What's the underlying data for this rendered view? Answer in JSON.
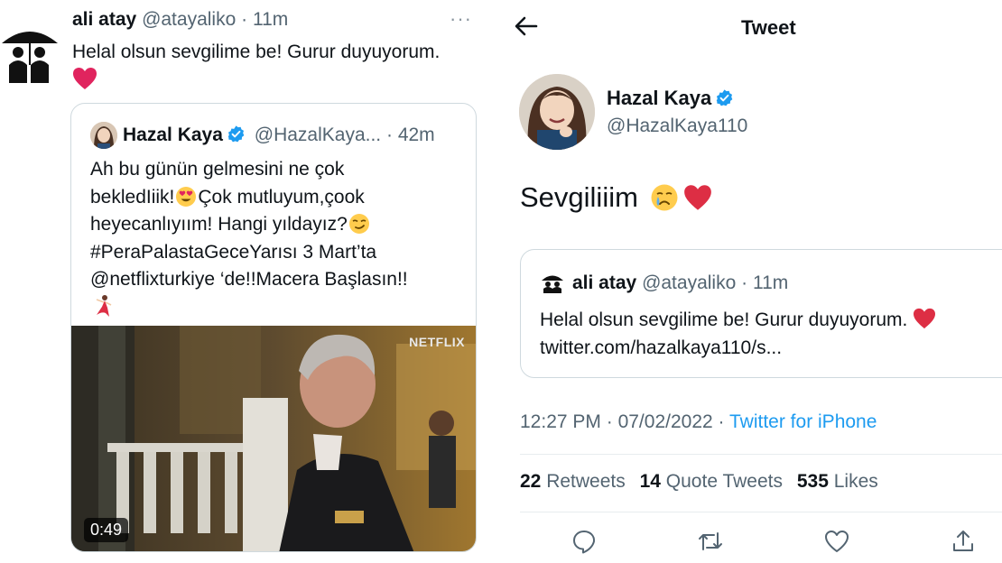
{
  "left_tweet": {
    "author_name": "ali atay",
    "author_handle": "@atayaliko",
    "separator": "·",
    "time": "11m",
    "more": "···",
    "text": "Helal olsun sevgilime be! Gurur duyuyorum.",
    "quoted": {
      "author_name": "Hazal Kaya",
      "author_handle": "@HazalKaya...",
      "separator": "·",
      "time": "42m",
      "lines": [
        "Ah bu günün gelmesini ne çok",
        "bekledIiik!",
        "Çok mutluyum,çook",
        "heyecanlıyıım! Hangi yıldayız?",
        "#PeraPalastaGeceYarısı 3 Mart’ta",
        "@netflixturkiye ‘de!!Macera Başlasın!!"
      ],
      "video": {
        "duration": "0:49",
        "brand": "NETFLIX"
      }
    }
  },
  "detail": {
    "header_title": "Tweet",
    "author_name": "Hazal Kaya",
    "author_handle": "@HazalKaya110",
    "text": "Sevgiliiim",
    "quoted": {
      "author_name": "ali atay",
      "author_handle": "@atayaliko",
      "separator": "·",
      "time": "11m",
      "line1": "Helal olsun sevgilime be! Gurur duyuyorum.",
      "line2": "twitter.com/hazalkaya110/s..."
    },
    "time": "12:27 PM",
    "separator": "·",
    "date": "07/02/2022",
    "source": "Twitter for iPhone",
    "stats": {
      "retweets_count": "22",
      "retweets_label": "Retweets",
      "quotes_count": "14",
      "quotes_label": "Quote Tweets",
      "likes_count": "535",
      "likes_label": "Likes"
    },
    "actions": [
      "reply-icon",
      "retweet-icon",
      "like-icon",
      "share-icon"
    ]
  },
  "colors": {
    "accent": "#1d9bf0",
    "text": "#0f1419",
    "muted": "#536471",
    "heart": "#e0245e",
    "border": "#cfd9de"
  }
}
